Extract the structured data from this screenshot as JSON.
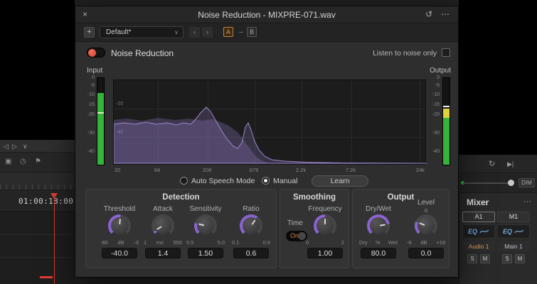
{
  "colors": {
    "accent": "#8a63d2",
    "meter_green": "#35b43a",
    "meter_yellow": "#ded23c",
    "toggle_red": "#d8463a",
    "ab_orange": "#d99a50",
    "eq_blue": "#6fa8dc",
    "track_orange": "#d9a35f",
    "main_name": "#b9c4ce",
    "playhead_red": "#e03c34"
  },
  "dialog": {
    "titlebar": {
      "close_icon": "×",
      "title": "Noise Reduction - MIXPRE-071.wav",
      "history_icon": "↺",
      "menu_icon": "⋯"
    },
    "preset_bar": {
      "add_icon": "+",
      "preset_name": "Default*",
      "chevron_icon": "∨",
      "prev_icon": "‹",
      "next_icon": "›",
      "a_label": "A",
      "arrow_icon": "→",
      "b_label": "B"
    },
    "enable_toggle_label": "Noise Reduction",
    "listen_checkbox_label": "Listen to noise only",
    "input_meter_label": "Input",
    "output_meter_label": "Output",
    "meter_scale": [
      "0",
      "-5",
      "-10",
      "-15",
      "-20",
      "-30",
      "-40"
    ],
    "graph": {
      "freq_labels": [
        "20",
        "64",
        "208",
        "679",
        "2.2k",
        "7.2k",
        "24k"
      ],
      "db_labels": [
        "-20",
        "-40"
      ]
    },
    "mode_row": {
      "auto_label": "Auto Speech Mode",
      "manual_label": "Manual",
      "learn_label": "Learn"
    },
    "sections": {
      "detection": {
        "title": "Detection",
        "knobs": [
          {
            "label": "Threshold",
            "min": "-80",
            "unit": "dB",
            "max": "-3",
            "value": "-40.0",
            "frac": 0.52
          },
          {
            "label": "Attack",
            "min": "1",
            "unit": "ms",
            "max": "500",
            "value": "1.4",
            "frac": 0.05
          },
          {
            "label": "Sensitivity",
            "min": "0.5",
            "unit": "",
            "max": "5.0",
            "value": "1.50",
            "frac": 0.22
          },
          {
            "label": "Ratio",
            "min": "0.1",
            "unit": "",
            "max": "0.9",
            "value": "0.6",
            "frac": 0.63
          }
        ]
      },
      "smoothing": {
        "title": "Smoothing",
        "time_label": "Time",
        "time_value": "On",
        "knob": {
          "label": "Frequency",
          "min": "0",
          "unit": "",
          "max": "2",
          "value": "1.00",
          "frac": 0.5
        }
      },
      "output": {
        "title": "Output",
        "knobs": [
          {
            "label": "Dry/Wet",
            "min": "Dry",
            "unit": "%",
            "max": "Wet",
            "value": "80.0",
            "frac": 0.8
          },
          {
            "label": "Level",
            "min": "-6",
            "unit": "dB",
            "max": "+18",
            "value": "0.0",
            "frac": 0.25,
            "scale_top": "0"
          }
        ]
      }
    }
  },
  "background": {
    "timecode": "01:00:18:00",
    "left_toolbar": {
      "prev_icon": "◁",
      "next_icon": "▷",
      "chevron_icon": "∨"
    },
    "left_tools": [
      "▣",
      "◷",
      "⚑"
    ],
    "transport": {
      "loop_icon": "↻",
      "skip_icon": "▶|"
    },
    "monitor": {
      "dim_label": "DIM"
    },
    "mixer": {
      "title": "Mixer",
      "menu_icon": "⋯",
      "strips": [
        {
          "id": "A1",
          "eq_label": "EQ",
          "name": "Audio 1",
          "solo_label": "S",
          "mute_label": "M"
        },
        {
          "id": "M1",
          "eq_label": "EQ",
          "name": "Main 1",
          "solo_label": "S",
          "mute_label": "M"
        }
      ]
    }
  }
}
